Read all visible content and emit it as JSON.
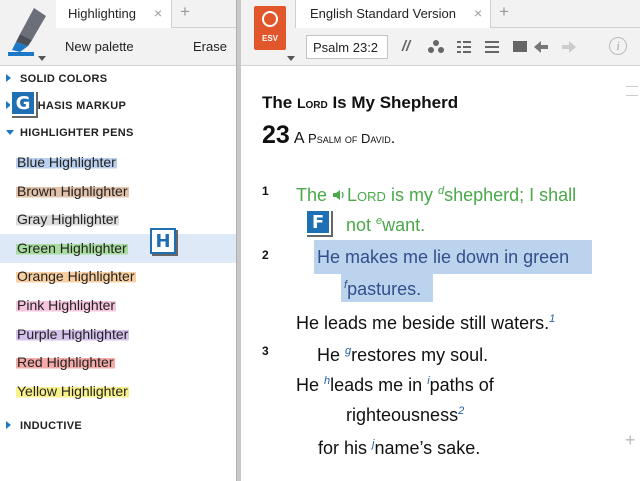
{
  "left": {
    "tab_label": "Highlighting",
    "tab_close": "×",
    "tab_plus": "+",
    "new_palette": "New palette",
    "erase": "Erase",
    "sections": {
      "solid": "SOLID COLORS",
      "emphasis": "PHASIS MARKUP",
      "pens": "HIGHLIGHTER PENS",
      "inductive": "INDUCTIVE"
    },
    "pens": [
      {
        "label": "Blue Highlighter",
        "color": "#b8d0ee"
      },
      {
        "label": "Brown Highlighter",
        "color": "#e2c2a8"
      },
      {
        "label": "Gray Highlighter",
        "color": "#dcdcdc"
      },
      {
        "label": "Green Highlighter",
        "color": "#a8dca0"
      },
      {
        "label": "Orange Highlighter",
        "color": "#f8cfa0"
      },
      {
        "label": "Pink Highlighter",
        "color": "#f6c6de"
      },
      {
        "label": "Purple Highlighter",
        "color": "#d4c2ec"
      },
      {
        "label": "Red Highlighter",
        "color": "#f4aaa6"
      },
      {
        "label": "Yellow Highlighter",
        "color": "#f8f08a"
      }
    ],
    "selected_pen_index": 3,
    "badge_g": "G",
    "badge_h": "H"
  },
  "right": {
    "esv_label": "ESV",
    "tab_label": "English Standard Version",
    "tab_close": "×",
    "tab_plus": "+",
    "reference": "Psalm 23:2",
    "badge_f": "F",
    "text": {
      "heading_pre": "The ",
      "heading_lord": "Lord",
      "heading_post": " Is My Shepherd",
      "psalm_num": "23",
      "psalm_a": "A ",
      "psalm_psalm": "Psalm",
      "psalm_of": " of ",
      "psalm_david": "David",
      "psalm_dot": ".",
      "v1": "1",
      "v2": "2",
      "v3": "3",
      "l1_the": "The ",
      "l1_lord": "Lord",
      "l1_mid": " is my ",
      "l1_note": "d",
      "l1_end": "shepherd; I shall",
      "l2_a": "not ",
      "l2_note": "e",
      "l2_b": "want.",
      "l3": "He makes me lie down in green",
      "l4_note": "f",
      "l4": "pastures.",
      "l5": "He leads me beside still waters.",
      "l5_note": "1",
      "l6_a": "He ",
      "l6_note": "g",
      "l6_b": "restores my soul.",
      "l7_a": "He ",
      "l7_note_h": "h",
      "l7_b": "leads me in ",
      "l7_note_i": "i",
      "l7_c": "paths of",
      "l8": "righteousness",
      "l8_note": "2",
      "l9_a": "for his ",
      "l9_note": "j",
      "l9_b": "name’s sake."
    }
  },
  "colors": {
    "accent_blue": "#1e78c8",
    "badge_blue": "#1f6fb5",
    "esv_orange": "#e2562b",
    "verse_green": "#4aa84a",
    "selection_blue": "#bcd3ee"
  },
  "icons": [
    "highlighter-marker-icon",
    "esv-book-icon",
    "parallel-icon",
    "visual-filter-icon",
    "multiview-icon",
    "panel-menu-icon",
    "text-size-icon",
    "back-icon",
    "forward-icon",
    "info-icon"
  ]
}
